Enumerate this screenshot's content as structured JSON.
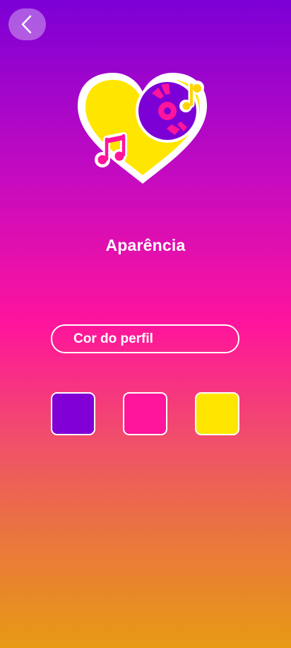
{
  "header": {
    "back_icon": "chevron-left-icon"
  },
  "hero": {
    "icon": "heart-vinyl-music-icon",
    "colors": {
      "heart": "#ffe600",
      "outline": "#ffffff",
      "vinyl": "#7c00d6",
      "accent": "#ff149c",
      "note_yellow": "#ffd400"
    }
  },
  "page": {
    "title": "Aparência"
  },
  "profile_color": {
    "label": "Cor do perfil"
  },
  "swatches": [
    {
      "name": "purple",
      "color": "#8000d6"
    },
    {
      "name": "pink",
      "color": "#ff149c"
    },
    {
      "name": "yellow",
      "color": "#ffe600"
    }
  ]
}
